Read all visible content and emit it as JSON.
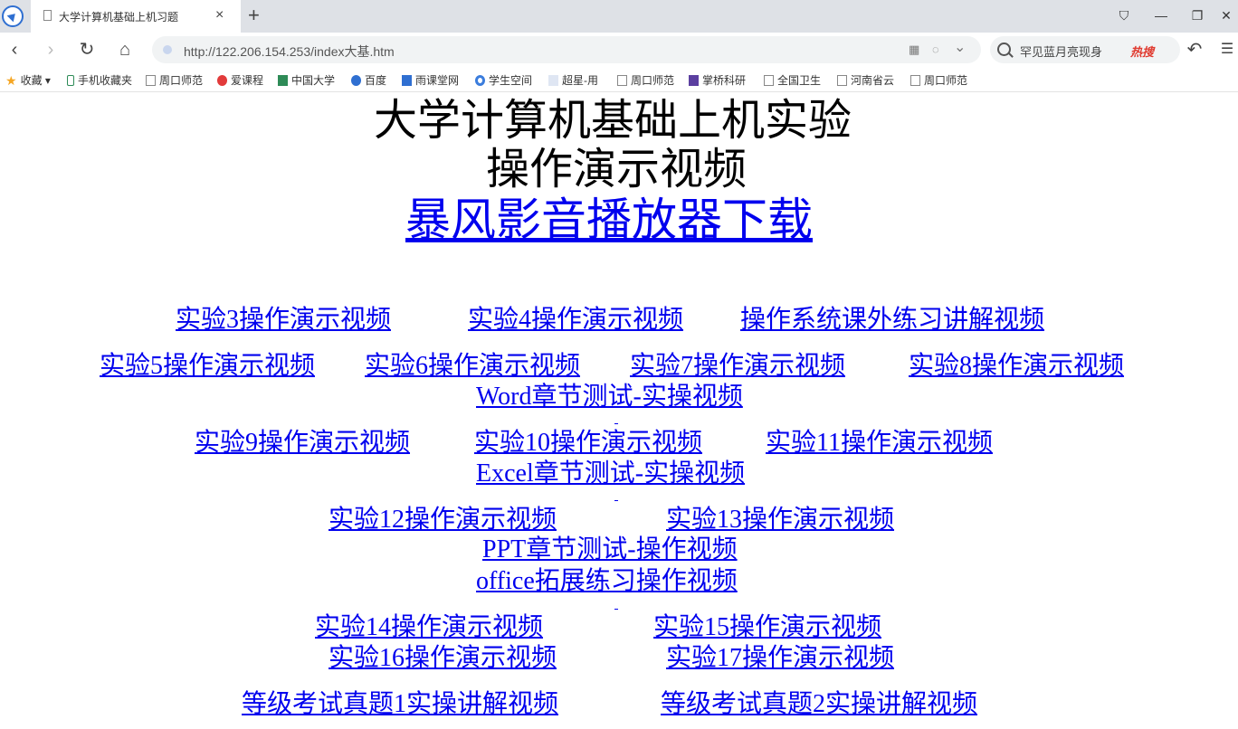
{
  "browser": {
    "tab_title": "大学计算机基础上机习题",
    "tab_close": "×",
    "new_tab": "+",
    "address": "http://122.206.154.253/index大基.htm",
    "search_text": "罕见蓝月亮现身",
    "hot_badge": "热搜",
    "back": "‹",
    "forward": "›",
    "reload": "↻",
    "home": "⌂",
    "undo": "↶",
    "menu": "☰",
    "win_minimize": "—",
    "win_restore": "❐",
    "win_close": "✕",
    "skin": "⛉",
    "addr_grid": "▦",
    "addr_compat": "◌",
    "addr_dropdown": "⌄",
    "bookmarks": [
      {
        "label": "收藏",
        "icon": "star-icon"
      },
      {
        "label": "手机收藏夹",
        "icon": "phone-icon"
      },
      {
        "label": "周口师范",
        "icon": "page-icon"
      },
      {
        "label": "爱课程",
        "icon": "icourse-icon"
      },
      {
        "label": "中国大学",
        "icon": "mooc-icon"
      },
      {
        "label": "百度",
        "icon": "baidu-icon"
      },
      {
        "label": "雨课堂网",
        "icon": "yuketang-icon"
      },
      {
        "label": "学生空间",
        "icon": "chrome-icon"
      },
      {
        "label": "超星-用",
        "icon": "chaoxing-icon"
      },
      {
        "label": "周口师范",
        "icon": "page-icon"
      },
      {
        "label": "掌桥科研",
        "icon": "zhangqiao-icon"
      },
      {
        "label": "全国卫生",
        "icon": "page-icon"
      },
      {
        "label": "河南省云",
        "icon": "page-icon"
      },
      {
        "label": "周口师范",
        "icon": "page-icon"
      }
    ]
  },
  "page": {
    "title_line1": "大学计算机基础上机实验",
    "title_line2": "操作演示视频",
    "player_link": "暴风影音播放器下载",
    "links": {
      "exp3": "实验3操作演示视频",
      "exp4": "实验4操作演示视频",
      "os_exercise": "操作系统课外练习讲解视频",
      "exp5": "实验5操作演示视频",
      "exp6": "实验6操作演示视频",
      "exp7": "实验7操作演示视频",
      "exp8": "实验8操作演示视频",
      "word_test": "Word章节测试-实操视频",
      "exp9": "实验9操作演示视频",
      "exp10": "实验10操作演示视频",
      "exp11": "实验11操作演示视频",
      "excel_test": "Excel章节测试-实操视频",
      "exp12": "实验12操作演示视频",
      "exp13": "实验13操作演示视频",
      "ppt_test": "PPT章节测试-操作视频",
      "office_ext": " office拓展练习操作视频",
      "exp14": "实验14操作演示视频",
      "exp15": "实验15操作演示视频",
      "exp16": "实验16操作演示视频",
      "exp17": "实验17操作演示视频",
      "exam1": "等级考试真题1实操讲解视频",
      "exam2": "等级考试真题2实操讲解视频"
    }
  }
}
